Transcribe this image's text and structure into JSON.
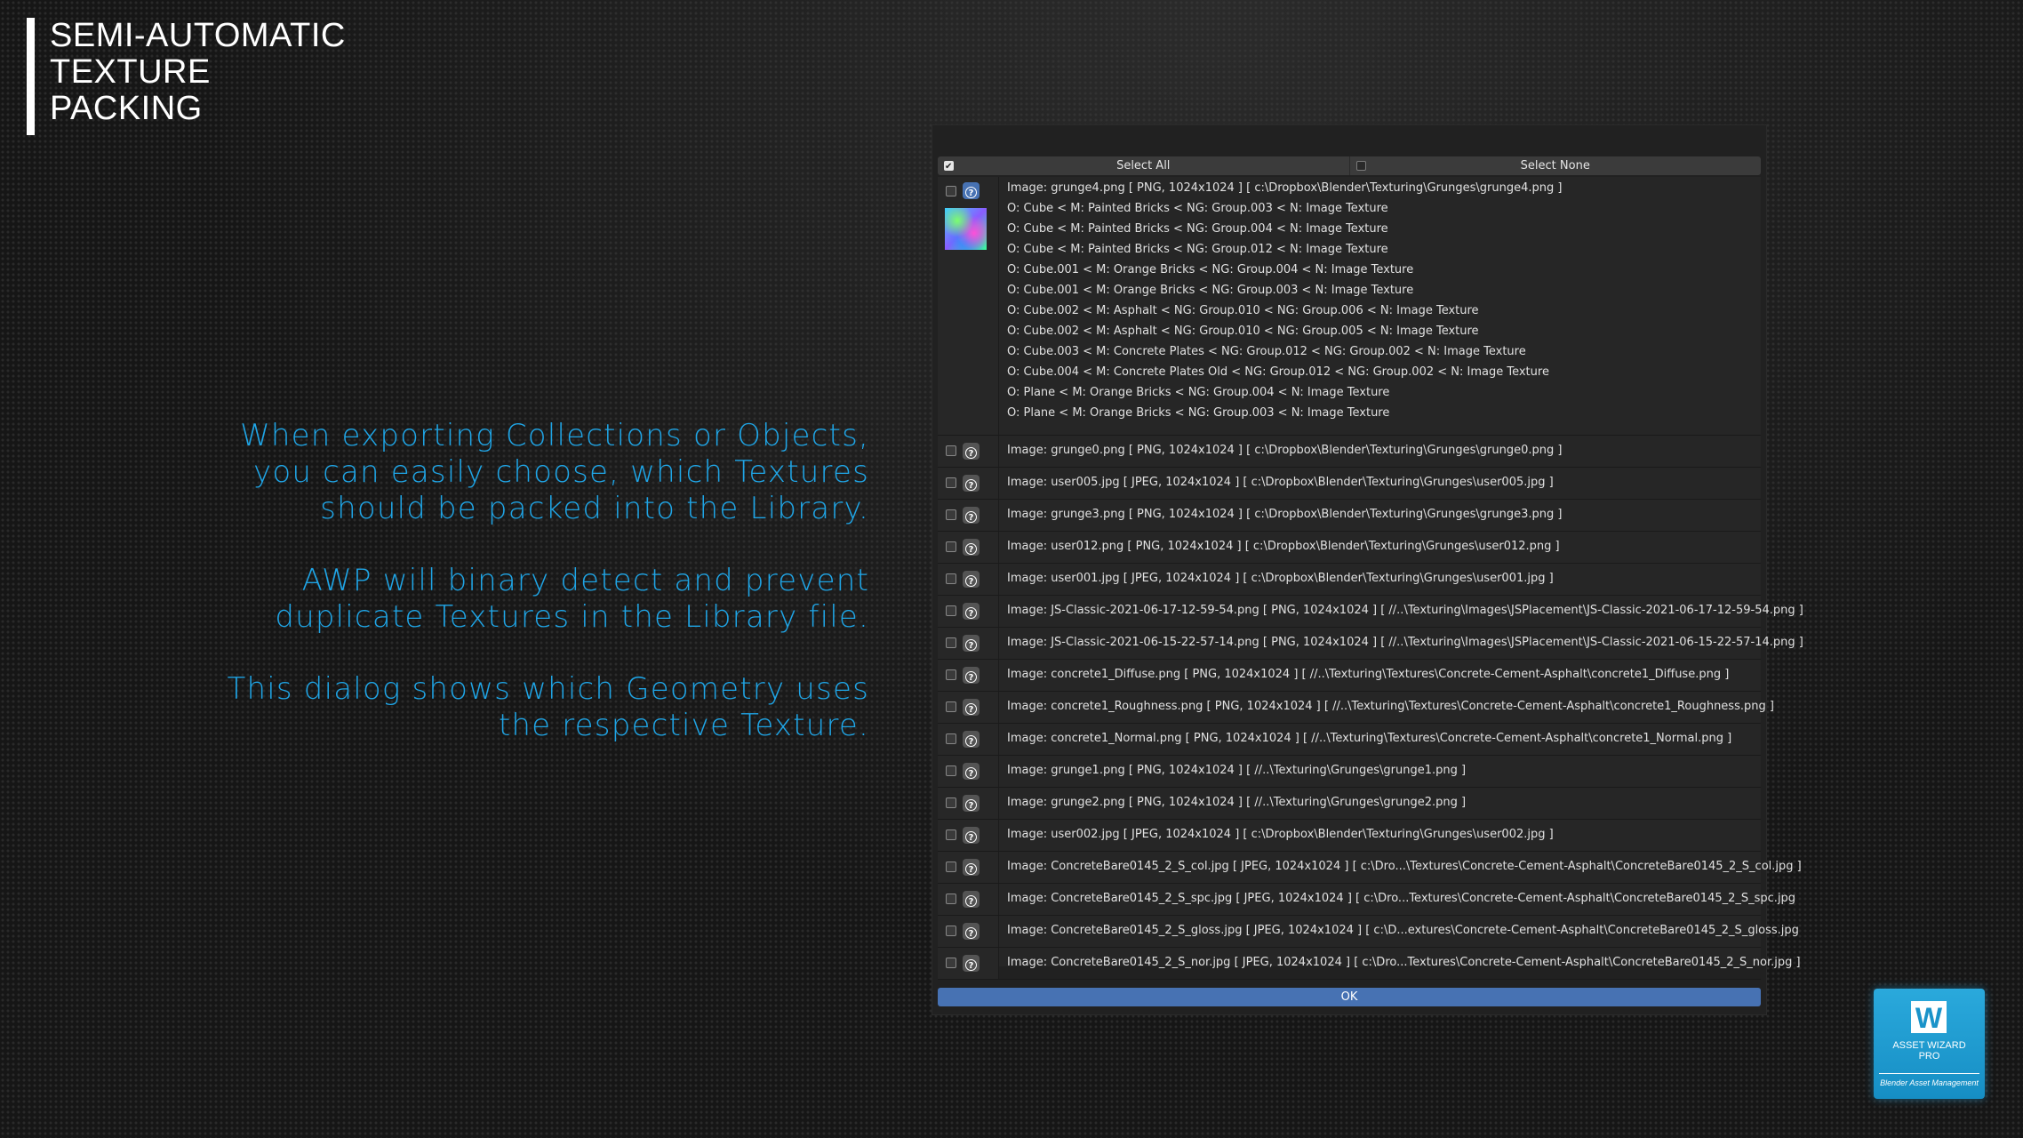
{
  "headline": [
    "SEMI-AUTOMATIC",
    "TEXTURE",
    "PACKING"
  ],
  "description": [
    [
      "When exporting Collections or Objects,",
      "you can easily choose, which Textures",
      "should be packed into the Library."
    ],
    [
      "AWP will binary detect and prevent",
      "duplicate Textures in the Library file."
    ],
    [
      "This dialog shows which Geometry uses",
      "the respective Texture."
    ]
  ],
  "dialog": {
    "select_all_label": "Select All",
    "select_all_checked": true,
    "select_none_label": "Select None",
    "select_none_checked": false,
    "ok_label": "OK",
    "expanded": {
      "image": "Image: grunge4.png [ PNG, 1024x1024 ]  [ c:\\Dropbox\\Blender\\Texturing\\Grunges\\grunge4.png ]",
      "usages": [
        "O: Cube < M: Painted Bricks < NG: Group.003 < N: Image Texture",
        "O: Cube < M: Painted Bricks < NG: Group.004 < N: Image Texture",
        "O: Cube < M: Painted Bricks < NG: Group.012 < N: Image Texture",
        "O: Cube.001 < M: Orange Bricks < NG: Group.004 < N: Image Texture",
        "O: Cube.001 < M: Orange Bricks < NG: Group.003 < N: Image Texture",
        "O: Cube.002 < M: Asphalt < NG: Group.010 < NG: Group.006 < N: Image Texture",
        "O: Cube.002 < M: Asphalt < NG: Group.010 < NG: Group.005 < N: Image Texture",
        "O: Cube.003 < M: Concrete Plates < NG: Group.012 < NG: Group.002 < N: Image Texture",
        "O: Cube.004 < M: Concrete Plates Old < NG: Group.012 < NG: Group.002 < N: Image Texture",
        "O: Plane < M: Orange Bricks < NG: Group.004 < N: Image Texture",
        "O: Plane < M: Orange Bricks < NG: Group.003 < N: Image Texture"
      ]
    },
    "images": [
      "Image: grunge0.png [ PNG, 1024x1024 ]  [ c:\\Dropbox\\Blender\\Texturing\\Grunges\\grunge0.png ]",
      "Image: user005.jpg [ JPEG, 1024x1024 ]  [ c:\\Dropbox\\Blender\\Texturing\\Grunges\\user005.jpg ]",
      "Image: grunge3.png [ PNG, 1024x1024 ]  [ c:\\Dropbox\\Blender\\Texturing\\Grunges\\grunge3.png ]",
      "Image: user012.png [ PNG, 1024x1024 ]  [ c:\\Dropbox\\Blender\\Texturing\\Grunges\\user012.png ]",
      "Image: user001.jpg [ JPEG, 1024x1024 ]  [ c:\\Dropbox\\Blender\\Texturing\\Grunges\\user001.jpg ]",
      "Image: JS-Classic-2021-06-17-12-59-54.png [ PNG, 1024x1024 ]  [ //..\\Texturing\\Images\\JSPlacement\\JS-Classic-2021-06-17-12-59-54.png ]",
      "Image: JS-Classic-2021-06-15-22-57-14.png [ PNG, 1024x1024 ]  [ //..\\Texturing\\Images\\JSPlacement\\JS-Classic-2021-06-15-22-57-14.png ]",
      "Image: concrete1_Diffuse.png [ PNG, 1024x1024 ]  [ //..\\Texturing\\Textures\\Concrete-Cement-Asphalt\\concrete1_Diffuse.png ]",
      "Image: concrete1_Roughness.png [ PNG, 1024x1024 ]  [ //..\\Texturing\\Textures\\Concrete-Cement-Asphalt\\concrete1_Roughness.png ]",
      "Image: concrete1_Normal.png [ PNG, 1024x1024 ]  [ //..\\Texturing\\Textures\\Concrete-Cement-Asphalt\\concrete1_Normal.png ]",
      "Image: grunge1.png [ PNG, 1024x1024 ]  [ //..\\Texturing\\Grunges\\grunge1.png ]",
      "Image: grunge2.png [ PNG, 1024x1024 ]  [ //..\\Texturing\\Grunges\\grunge2.png ]",
      "Image: user002.jpg [ JPEG, 1024x1024 ]  [ c:\\Dropbox\\Blender\\Texturing\\Grunges\\user002.jpg ]",
      "Image: ConcreteBare0145_2_S_col.jpg [ JPEG, 1024x1024 ]  [ c:\\Dro...\\Textures\\Concrete-Cement-Asphalt\\ConcreteBare0145_2_S_col.jpg ]",
      "Image: ConcreteBare0145_2_S_spc.jpg [ JPEG, 1024x1024 ]  [ c:\\Dro...Textures\\Concrete-Cement-Asphalt\\ConcreteBare0145_2_S_spc.jpg",
      "Image: ConcreteBare0145_2_S_gloss.jpg [ JPEG, 1024x1024 ]  [ c:\\D...extures\\Concrete-Cement-Asphalt\\ConcreteBare0145_2_S_gloss.jpg",
      "Image: ConcreteBare0145_2_S_nor.jpg [ JPEG, 1024x1024 ]  [ c:\\Dro...Textures\\Concrete-Cement-Asphalt\\ConcreteBare0145_2_S_nor.jpg ]"
    ]
  },
  "badge": {
    "logo_letter": "W",
    "name_line1": "ASSET WIZARD",
    "name_line2": "PRO",
    "subtitle": "Blender Asset Management"
  },
  "colors": {
    "accent_blue": "#1fa5e6",
    "button_blue": "#4772b3",
    "panel_bg": "#212121"
  }
}
